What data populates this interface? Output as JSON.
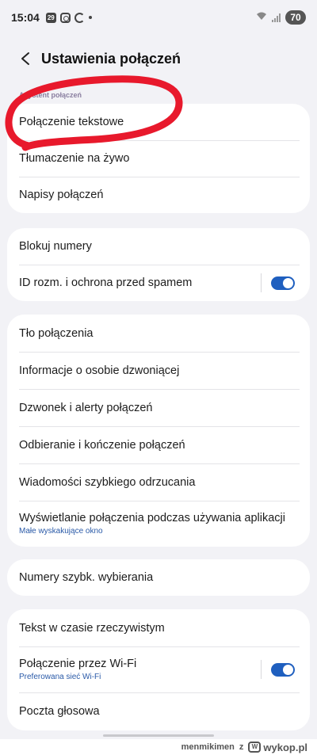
{
  "status_bar": {
    "time": "15:04",
    "badge": "29",
    "battery": "70"
  },
  "header": {
    "title": "Ustawienia połączeń"
  },
  "section_asystent": {
    "label": "Asystent połączeń",
    "items": [
      {
        "label": "Połączenie tekstowe"
      },
      {
        "label": "Tłumaczenie na żywo"
      },
      {
        "label": "Napisy połączeń"
      }
    ]
  },
  "section_blocking": {
    "items": [
      {
        "label": "Blokuj numery"
      },
      {
        "label": "ID rozm. i ochrona przed spamem",
        "toggle_on": true
      }
    ]
  },
  "section_general": {
    "items": [
      {
        "label": "Tło połączenia"
      },
      {
        "label": "Informacje o osobie dzwoniącej"
      },
      {
        "label": "Dzwonek i alerty połączeń"
      },
      {
        "label": "Odbieranie i kończenie połączeń"
      },
      {
        "label": "Wiadomości szybkiego odrzucania"
      },
      {
        "label": "Wyświetlanie połączenia podczas używania aplikacji",
        "sub": "Małe wyskakujące okno"
      }
    ]
  },
  "section_speed": {
    "items": [
      {
        "label": "Numery szybk. wybierania"
      }
    ]
  },
  "section_other": {
    "items": [
      {
        "label": "Tekst w czasie rzeczywistym"
      },
      {
        "label": "Połączenie przez Wi-Fi",
        "sub": "Preferowana sieć Wi-Fi",
        "toggle_on": true
      },
      {
        "label": "Poczta głosowa"
      }
    ]
  },
  "watermark": {
    "user": "menmikimen",
    "connector": "z",
    "site": "wykop.pl"
  },
  "colors": {
    "accent": "#1f5fbf",
    "annotation": "#e8192c",
    "background": "#f2f2f6"
  }
}
